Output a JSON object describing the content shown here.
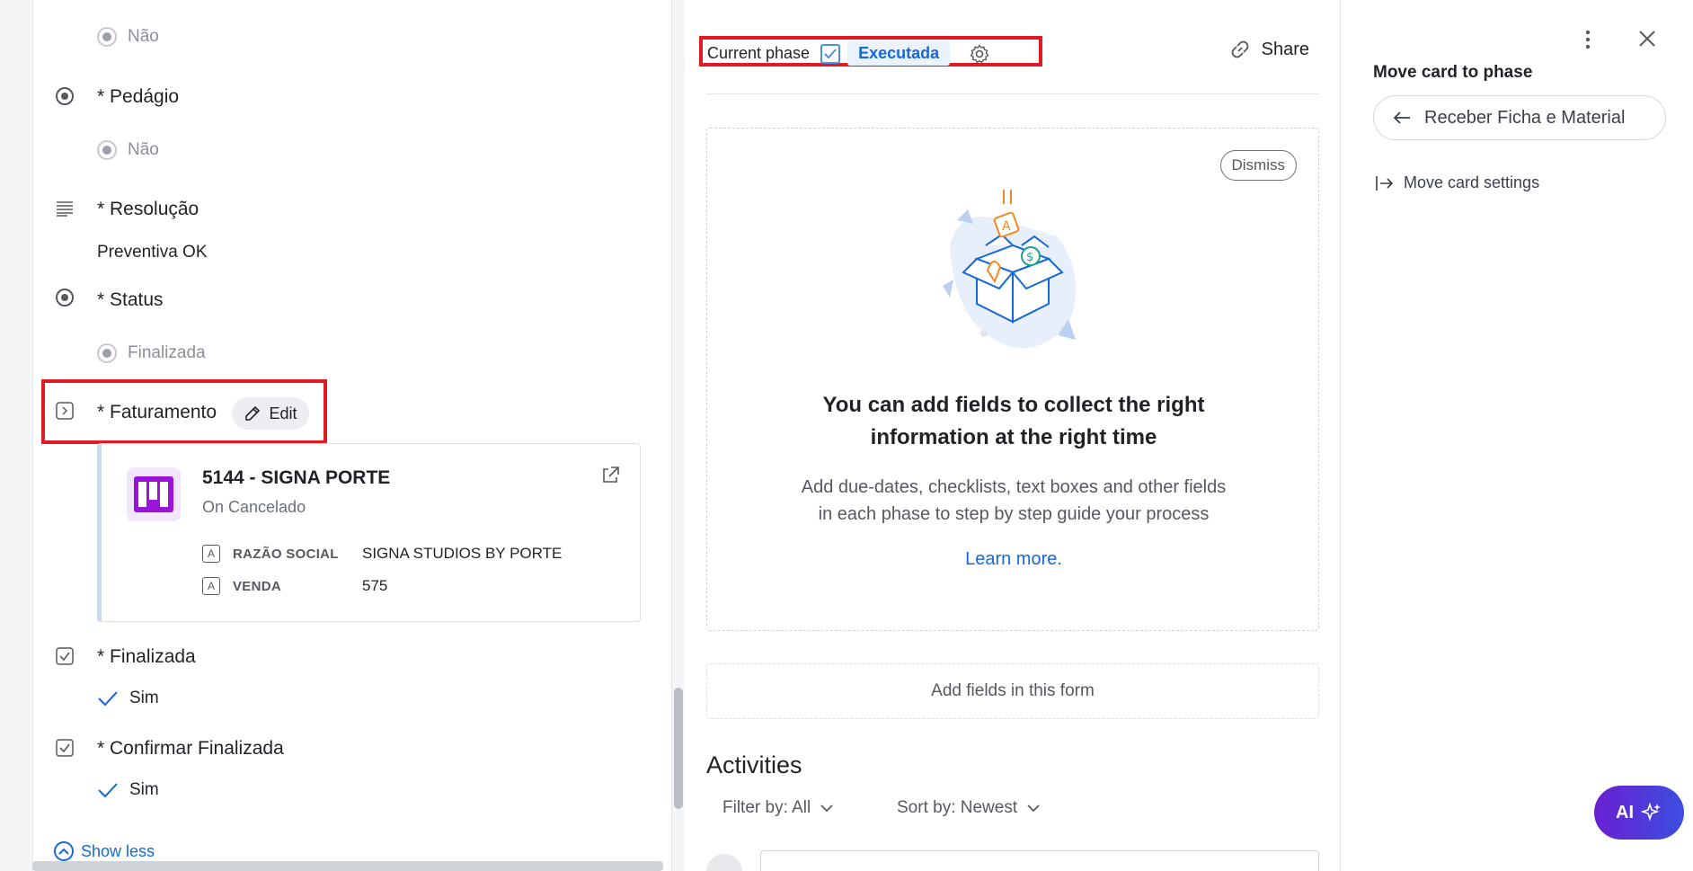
{
  "left": {
    "fields": [
      {
        "option_nao_top": "Não"
      },
      {
        "title": "* Pedágio",
        "value": "Não"
      },
      {
        "title": "* Resolução",
        "value": "Preventiva OK"
      },
      {
        "title": "* Status",
        "value": "Finalizada"
      },
      {
        "title": "* Faturamento",
        "edit_label": "Edit"
      },
      {
        "title": "* Finalizada",
        "value": "Sim"
      },
      {
        "title": "* Confirmar Finalizada",
        "value": "Sim"
      }
    ],
    "connected_card": {
      "title": "5144 - SIGNA PORTE",
      "subtitle": "On Cancelado",
      "rows": [
        {
          "key": "RAZÃO SOCIAL",
          "value": "SIGNA STUDIOS BY PORTE"
        },
        {
          "key": "VENDA",
          "value": "575"
        }
      ]
    },
    "show_less": "Show less"
  },
  "middle": {
    "current_phase_label": "Current phase",
    "phase_name": "Executada",
    "share_label": "Share",
    "dismiss_label": "Dismiss",
    "empty_title": "You can add fields to collect the right information at the right time",
    "empty_desc_line1": "Add due-dates, checklists, text boxes and other fields",
    "empty_desc_line2": "in each phase to step by step guide your process",
    "learn_more": "Learn more.",
    "add_fields": "Add fields in this form",
    "activities_title": "Activities",
    "filter_label": "Filter by: All",
    "sort_label": "Sort by: Newest"
  },
  "right": {
    "move_title": "Move card to phase",
    "move_target": "Receber Ficha e Material",
    "move_settings": "Move card settings",
    "ai_label": "AI"
  },
  "colors": {
    "accent": "#1667d9",
    "highlight_border": "#e01b24",
    "ai_gradient_start": "#6a1fd1",
    "ai_gradient_end": "#3b4fe0"
  }
}
